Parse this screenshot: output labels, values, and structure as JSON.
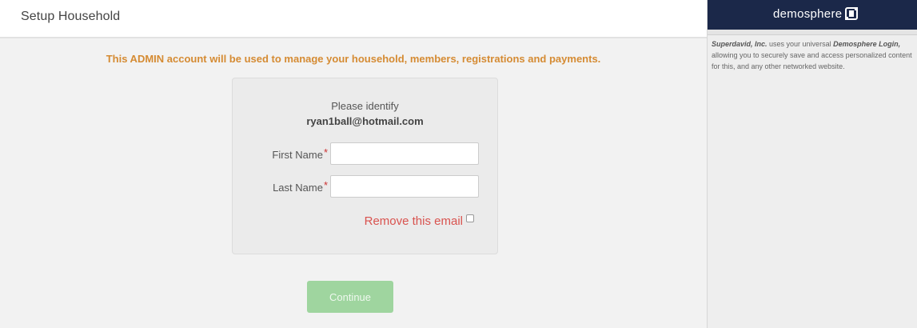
{
  "header": {
    "title": "Setup Household"
  },
  "notice": "This ADMIN account will be used to manage your household, members, registrations and payments.",
  "form": {
    "identify_text": "Please identify",
    "email": "ryan1ball@hotmail.com",
    "required_marker": "*",
    "first_name": {
      "label": "First Name",
      "value": "",
      "placeholder": ""
    },
    "last_name": {
      "label": "Last Name",
      "value": "",
      "placeholder": ""
    },
    "remove_email_label": "Remove this email",
    "remove_email_checked": false
  },
  "continue_label": "Continue",
  "sidebar": {
    "brand": "demosphere",
    "brand_icon": "demosphere-logo-icon",
    "org_name": "Superdavid, Inc.",
    "text_1": " uses your universal ",
    "product_name": "Demosphere Login,",
    "text_2": " allowing you to securely save and access personalized content for this, and any other networked website."
  },
  "colors": {
    "notice": "#d58b33",
    "remove_link": "#d9534f",
    "continue_button": "#9fd59f",
    "brand_bar": "#1b2849"
  }
}
